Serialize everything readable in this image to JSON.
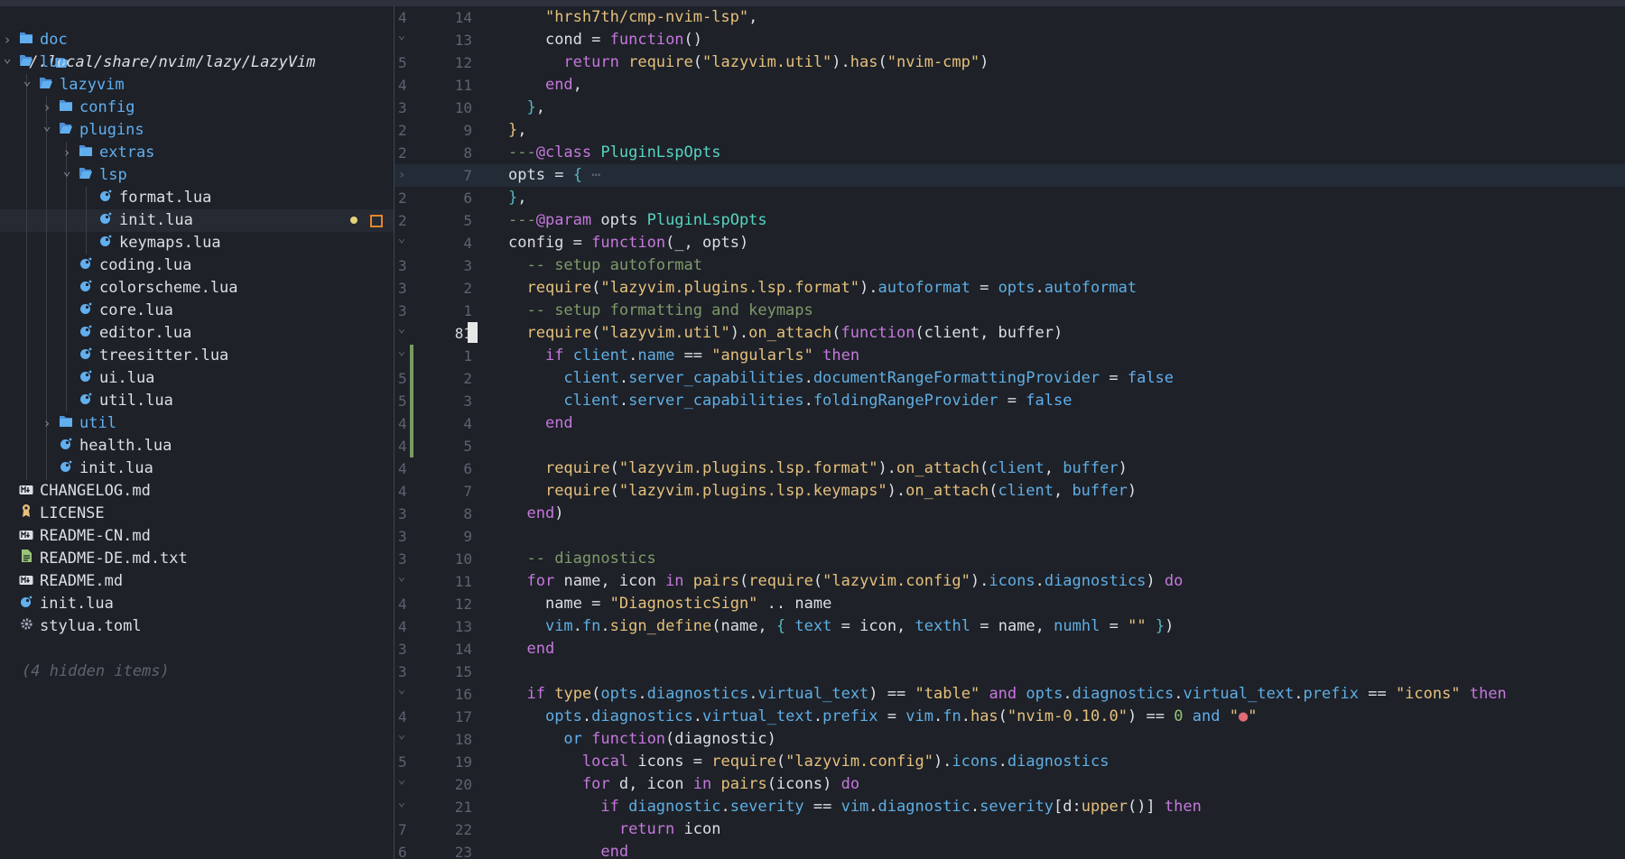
{
  "tree": {
    "root_path": "~/.local/share/nvim/lazy/LazyVim",
    "hidden_items": "(4 hidden items)",
    "items": [
      {
        "label": "doc",
        "kind": "folder",
        "depth": 0,
        "expanded": false
      },
      {
        "label": "lua",
        "kind": "folder",
        "depth": 0,
        "expanded": true
      },
      {
        "label": "lazyvim",
        "kind": "folder",
        "depth": 1,
        "expanded": true
      },
      {
        "label": "config",
        "kind": "folder",
        "depth": 2,
        "expanded": false
      },
      {
        "label": "plugins",
        "kind": "folder",
        "depth": 2,
        "expanded": true
      },
      {
        "label": "extras",
        "kind": "folder",
        "depth": 3,
        "expanded": false
      },
      {
        "label": "lsp",
        "kind": "folder",
        "depth": 3,
        "expanded": true
      },
      {
        "label": "format.lua",
        "kind": "lua",
        "depth": 4
      },
      {
        "label": "init.lua",
        "kind": "lua",
        "depth": 4,
        "selected": true,
        "modified": true
      },
      {
        "label": "keymaps.lua",
        "kind": "lua",
        "depth": 4
      },
      {
        "label": "coding.lua",
        "kind": "lua",
        "depth": 3
      },
      {
        "label": "colorscheme.lua",
        "kind": "lua",
        "depth": 3
      },
      {
        "label": "core.lua",
        "kind": "lua",
        "depth": 3
      },
      {
        "label": "editor.lua",
        "kind": "lua",
        "depth": 3
      },
      {
        "label": "treesitter.lua",
        "kind": "lua",
        "depth": 3
      },
      {
        "label": "ui.lua",
        "kind": "lua",
        "depth": 3
      },
      {
        "label": "util.lua",
        "kind": "lua",
        "depth": 3
      },
      {
        "label": "util",
        "kind": "folder",
        "depth": 2,
        "expanded": false
      },
      {
        "label": "health.lua",
        "kind": "lua",
        "depth": 2
      },
      {
        "label": "init.lua",
        "kind": "lua",
        "depth": 2
      },
      {
        "label": "CHANGELOG.md",
        "kind": "md",
        "depth": 0
      },
      {
        "label": "LICENSE",
        "kind": "license",
        "depth": 0
      },
      {
        "label": "README-CN.md",
        "kind": "md",
        "depth": 0
      },
      {
        "label": "README-DE.md.txt",
        "kind": "txt",
        "depth": 0
      },
      {
        "label": "README.md",
        "kind": "md",
        "depth": 0
      },
      {
        "label": "init.lua",
        "kind": "lua",
        "depth": 0
      },
      {
        "label": "stylua.toml",
        "kind": "toml",
        "depth": 0
      }
    ]
  },
  "editor": {
    "lines": [
      {
        "rel": "4",
        "num": "14",
        "fold": "",
        "html": "    <span class=\"y\">\"hrsh7th/cmp-nvim-lsp\"</span><span class=\"w\">,</span>"
      },
      {
        "rel": "",
        "num": "13",
        "fold": "v",
        "html": "    <span class=\"w\">cond</span> <span class=\"w\">=</span> <span class=\"k\">function</span><span class=\"w\">()</span>"
      },
      {
        "rel": "5",
        "num": "12",
        "fold": "",
        "html": "      <span class=\"k\">return</span> <span class=\"y\">require</span><span class=\"w\">(</span><span class=\"y\">\"lazyvim.util\"</span><span class=\"w\">).</span><span class=\"y\">has</span><span class=\"w\">(</span><span class=\"y\">\"nvim-cmp\"</span><span class=\"w\">)</span>"
      },
      {
        "rel": "4",
        "num": "11",
        "fold": "",
        "html": "    <span class=\"k\">end</span><span class=\"w\">,</span>"
      },
      {
        "rel": "3",
        "num": "10",
        "fold": "",
        "html": "  <span class=\"cyan\">}</span><span class=\"w\">,</span>"
      },
      {
        "rel": "2",
        "num": "9",
        "fold": "",
        "html": "<span class=\"y\">}</span><span class=\"w\">,</span>"
      },
      {
        "rel": "2",
        "num": "8",
        "fold": "",
        "html": "<span class=\"c\">---</span><span class=\"ann\">@class</span> <span class=\"cls\">PluginLspOpts</span>"
      },
      {
        "rel": "",
        "num": "7",
        "fold": ">",
        "cursorline": true,
        "html": "<span class=\"w\">opts</span> <span class=\"w\">=</span> <span class=\"cyan\">{</span> <span class=\"dim\">⋯</span>"
      },
      {
        "rel": "2",
        "num": "6",
        "fold": "",
        "html": "<span class=\"cyan\">}</span><span class=\"w\">,</span>"
      },
      {
        "rel": "2",
        "num": "5",
        "fold": "",
        "html": "<span class=\"c\">---</span><span class=\"ann\">@param</span> <span class=\"w\">opts</span> <span class=\"cls\">PluginLspOpts</span>"
      },
      {
        "rel": "",
        "num": "4",
        "fold": "v",
        "html": "<span class=\"w\">config</span> <span class=\"w\">=</span> <span class=\"k\">function</span><span class=\"w\">(_, opts)</span>"
      },
      {
        "rel": "3",
        "num": "3",
        "fold": "",
        "html": "  <span class=\"c\">-- setup autoformat</span>"
      },
      {
        "rel": "3",
        "num": "2",
        "fold": "",
        "html": "  <span class=\"y\">require</span><span class=\"w\">(</span><span class=\"y\">\"lazyvim.plugins.lsp.format\"</span><span class=\"w\">).</span><span class=\"b\">autoformat</span> <span class=\"w\">=</span> <span class=\"b\">opts</span><span class=\"w\">.</span><span class=\"b\">autoformat</span>"
      },
      {
        "rel": "3",
        "num": "1",
        "fold": "",
        "html": "  <span class=\"c\">-- setup formatting and keymaps</span>"
      },
      {
        "rel": "",
        "num": "81",
        "fold": "v",
        "cur": true,
        "html": "  <span class=\"y\">require</span><span class=\"w\">(</span><span class=\"y\">\"lazyvim.util\"</span><span class=\"w\">).</span><span class=\"y\">on_attach</span><span class=\"w\">(</span><span class=\"k\">function</span><span class=\"w\">(client, buffer)</span>"
      },
      {
        "rel": "",
        "num": "1",
        "fold": "v",
        "git": true,
        "html": "    <span class=\"k\">if</span> <span class=\"b\">client</span><span class=\"w\">.</span><span class=\"b\">name</span> <span class=\"w\">==</span> <span class=\"y\">\"angularls\"</span> <span class=\"k\">then</span>"
      },
      {
        "rel": "5",
        "num": "2",
        "fold": "",
        "git": true,
        "html": "      <span class=\"b\">client</span><span class=\"w\">.</span><span class=\"b\">server_capabilities</span><span class=\"w\">.</span><span class=\"b\">documentRangeFormattingProvider</span> <span class=\"w\">=</span> <span class=\"fn\">false</span>"
      },
      {
        "rel": "5",
        "num": "3",
        "fold": "",
        "git": true,
        "html": "      <span class=\"b\">client</span><span class=\"w\">.</span><span class=\"b\">server_capabilities</span><span class=\"w\">.</span><span class=\"b\">foldingRangeProvider</span> <span class=\"w\">=</span> <span class=\"fn\">false</span>"
      },
      {
        "rel": "4",
        "num": "4",
        "fold": "",
        "git": true,
        "html": "    <span class=\"k\">end</span>"
      },
      {
        "rel": "4",
        "num": "5",
        "fold": "",
        "git": true,
        "html": ""
      },
      {
        "rel": "4",
        "num": "6",
        "fold": "",
        "html": "    <span class=\"y\">require</span><span class=\"w\">(</span><span class=\"y\">\"lazyvim.plugins.lsp.format\"</span><span class=\"w\">).</span><span class=\"y\">on_attach</span><span class=\"w\">(</span><span class=\"b\">client</span><span class=\"w\">, </span><span class=\"b\">buffer</span><span class=\"w\">)</span>"
      },
      {
        "rel": "4",
        "num": "7",
        "fold": "",
        "html": "    <span class=\"y\">require</span><span class=\"w\">(</span><span class=\"y\">\"lazyvim.plugins.lsp.keymaps\"</span><span class=\"w\">).</span><span class=\"y\">on_attach</span><span class=\"w\">(</span><span class=\"b\">client</span><span class=\"w\">, </span><span class=\"b\">buffer</span><span class=\"w\">)</span>"
      },
      {
        "rel": "3",
        "num": "8",
        "fold": "",
        "html": "  <span class=\"k\">end</span><span class=\"w\">)</span>"
      },
      {
        "rel": "3",
        "num": "9",
        "fold": "",
        "html": ""
      },
      {
        "rel": "3",
        "num": "10",
        "fold": "",
        "html": "  <span class=\"c\">-- diagnostics</span>"
      },
      {
        "rel": "",
        "num": "11",
        "fold": "v",
        "html": "  <span class=\"k\">for</span> <span class=\"w\">name, icon</span> <span class=\"k\">in</span> <span class=\"y\">pairs</span><span class=\"w\">(</span><span class=\"y\">require</span><span class=\"w\">(</span><span class=\"y\">\"lazyvim.config\"</span><span class=\"w\">).</span><span class=\"b\">icons</span><span class=\"w\">.</span><span class=\"b\">diagnostics</span><span class=\"w\">)</span> <span class=\"k\">do</span>"
      },
      {
        "rel": "4",
        "num": "12",
        "fold": "",
        "html": "    <span class=\"w\">name</span> <span class=\"w\">=</span> <span class=\"y\">\"DiagnosticSign\"</span> <span class=\"w\">..</span> <span class=\"w\">name</span>"
      },
      {
        "rel": "4",
        "num": "13",
        "fold": "",
        "html": "    <span class=\"b\">vim</span><span class=\"w\">.</span><span class=\"b\">fn</span><span class=\"w\">.</span><span class=\"y\">sign_define</span><span class=\"w\">(name, </span><span class=\"cyan\">{</span> <span class=\"b\">text</span> <span class=\"w\">=</span> <span class=\"w\">icon,</span> <span class=\"b\">texthl</span> <span class=\"w\">=</span> <span class=\"w\">name,</span> <span class=\"b\">numhl</span> <span class=\"w\">=</span> <span class=\"y\">\"\"</span> <span class=\"cyan\">}</span><span class=\"w\">)</span>"
      },
      {
        "rel": "3",
        "num": "14",
        "fold": "",
        "html": "  <span class=\"k\">end</span>"
      },
      {
        "rel": "3",
        "num": "15",
        "fold": "",
        "html": ""
      },
      {
        "rel": "",
        "num": "16",
        "fold": "v",
        "html": "  <span class=\"k\">if</span> <span class=\"y\">type</span><span class=\"w\">(</span><span class=\"b\">opts</span><span class=\"w\">.</span><span class=\"b\">diagnostics</span><span class=\"w\">.</span><span class=\"b\">virtual_text</span><span class=\"w\">)</span> <span class=\"w\">==</span> <span class=\"y\">\"table\"</span> <span class=\"k\">and</span> <span class=\"b\">opts</span><span class=\"w\">.</span><span class=\"b\">diagnostics</span><span class=\"w\">.</span><span class=\"b\">virtual_text</span><span class=\"w\">.</span><span class=\"b\">prefix</span> <span class=\"w\">==</span> <span class=\"y\">\"icons\"</span> <span class=\"k\">then</span>"
      },
      {
        "rel": "4",
        "num": "17",
        "fold": "",
        "html": "    <span class=\"b\">opts</span><span class=\"w\">.</span><span class=\"b\">diagnostics</span><span class=\"w\">.</span><span class=\"b\">virtual_text</span><span class=\"w\">.</span><span class=\"b\">prefix</span> <span class=\"w\">=</span> <span class=\"b\">vim</span><span class=\"w\">.</span><span class=\"b\">fn</span><span class=\"w\">.</span><span class=\"y\">has</span><span class=\"w\">(</span><span class=\"y\">\"nvim-0.10.0\"</span><span class=\"w\">)</span> <span class=\"w\">==</span> <span class=\"g\">0</span> <span class=\"fn\">and</span> <span class=\"y\">\"</span><span class=\"pink\">●</span><span class=\"y\">\"</span>"
      },
      {
        "rel": "",
        "num": "18",
        "fold": "v",
        "html": "      <span class=\"fn\">or</span> <span class=\"k\">function</span><span class=\"w\">(diagnostic)</span>"
      },
      {
        "rel": "5",
        "num": "19",
        "fold": "",
        "html": "        <span class=\"k\">local</span> <span class=\"w\">icons</span> <span class=\"w\">=</span> <span class=\"y\">require</span><span class=\"w\">(</span><span class=\"y\">\"lazyvim.config\"</span><span class=\"w\">).</span><span class=\"b\">icons</span><span class=\"w\">.</span><span class=\"b\">diagnostics</span>"
      },
      {
        "rel": "",
        "num": "20",
        "fold": "v",
        "html": "        <span class=\"k\">for</span> <span class=\"w\">d, icon</span> <span class=\"k\">in</span> <span class=\"y\">pairs</span><span class=\"w\">(icons)</span> <span class=\"k\">do</span>"
      },
      {
        "rel": "",
        "num": "21",
        "fold": "v",
        "html": "          <span class=\"k\">if</span> <span class=\"b\">diagnostic</span><span class=\"w\">.</span><span class=\"b\">severity</span> <span class=\"w\">==</span> <span class=\"b\">vim</span><span class=\"w\">.</span><span class=\"b\">diagnostic</span><span class=\"w\">.</span><span class=\"b\">severity</span><span class=\"w\">[d:</span><span class=\"y\">upper</span><span class=\"w\">()]</span> <span class=\"k\">then</span>"
      },
      {
        "rel": "7",
        "num": "22",
        "fold": "",
        "html": "            <span class=\"k\">return</span> <span class=\"w\">icon</span>"
      },
      {
        "rel": "6",
        "num": "23",
        "fold": "",
        "html": "          <span class=\"k\">end</span>"
      }
    ]
  }
}
